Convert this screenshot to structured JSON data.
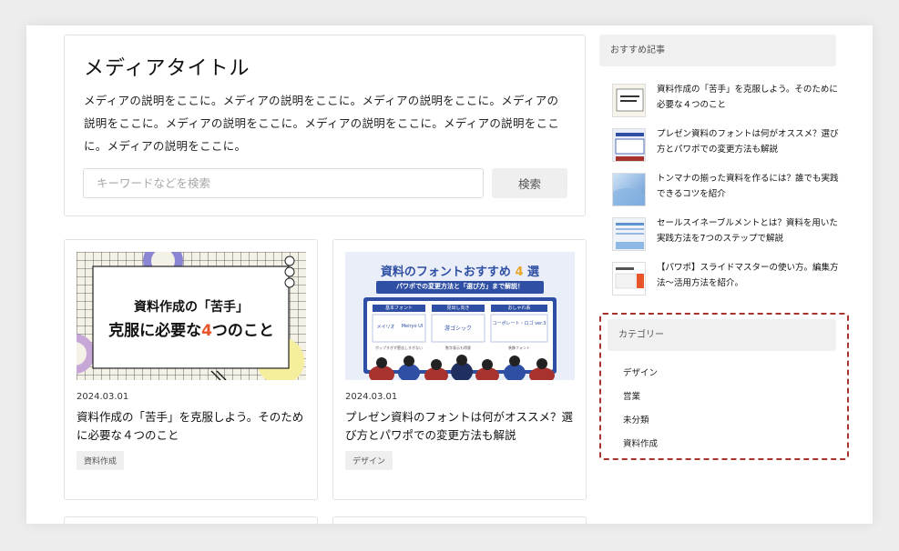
{
  "hero": {
    "title": "メディアタイトル",
    "description": "メディアの説明をここに。メディアの説明をここに。メディアの説明をここに。メディアの説明をここに。メディアの説明をここに。メディアの説明をここに。メディアの説明をここに。メディアの説明をここに。",
    "search_placeholder": "キーワードなどを検索",
    "search_button": "検索"
  },
  "articles": [
    {
      "date": "2024.03.01",
      "title": "資料作成の「苦手」を克服しよう。そのために必要な４つのこと",
      "tag": "資料作成",
      "thumb_line1": "資料作成の「苦手」",
      "thumb_line2a": "克服に必要な",
      "thumb_num": "4",
      "thumb_line2b": "つのこと"
    },
    {
      "date": "2024.03.01",
      "title": "プレゼン資料のフォントは何がオススメ？選び方とパワポでの変更方法も解説",
      "tag": "デザイン",
      "thumb_title_a": "資料のフォントおすすめ",
      "thumb_num": "4",
      "thumb_title_b": "選",
      "thumb_banner": "パワポでの変更方法と「選び方」まで解説！",
      "thumb_col_heads": [
        "基本フォント",
        "見出し向き",
        "おしゃれ系"
      ],
      "thumb_fonts": [
        "メイリオ",
        "Meiryo UI",
        "游ゴシック",
        "コーポレート・ロゴ ver.3"
      ],
      "thumb_notes": [
        "ポップすぎず堅苦しすぎない",
        "数字表示も得意",
        "装飾フォント"
      ]
    }
  ],
  "sidebar": {
    "recommended_heading": "おすすめ記事",
    "recommended": [
      {
        "title": "資料作成の「苦手」を克服しよう。そのために必要な４つのこと"
      },
      {
        "title": "プレゼン資料のフォントは何がオススメ？選び方とパワポでの変更方法も解説"
      },
      {
        "title": "トンマナの揃った資料を作るには？誰でも実践できるコツを紹介"
      },
      {
        "title": "セールスイネーブルメントとは？資料を用いた実践方法を7つのステップで解説"
      },
      {
        "title": "【パワポ】スライドマスターの使い方。編集方法〜活用方法を紹介。"
      }
    ],
    "category_heading": "カテゴリー",
    "categories": [
      "デザイン",
      "営業",
      "未分類",
      "資料作成"
    ]
  },
  "colors": {
    "accent_orange": "#e8552b",
    "dashed_highlight": "#a8322d",
    "font_thumb_blue": "#2e4fa3"
  }
}
